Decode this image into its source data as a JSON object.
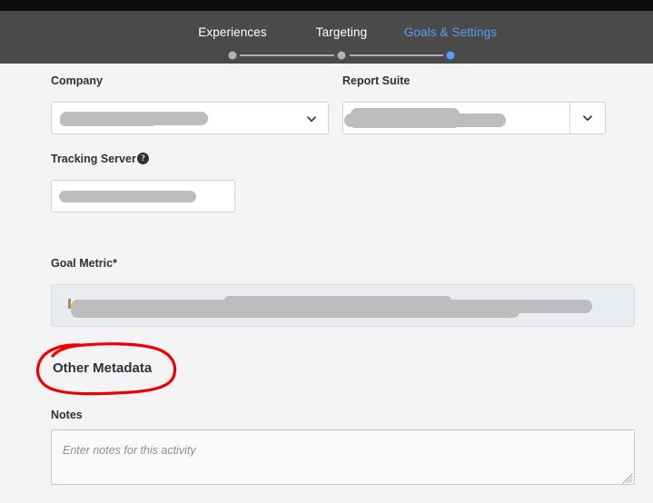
{
  "window": {
    "chrome_color": "#0d0d0d",
    "header_color": "#4a4a4a",
    "page_background": "#f4f4f4",
    "accent_color": "#5a9cf0"
  },
  "wizard": {
    "steps": [
      {
        "label": "Experiences",
        "state": "inactive"
      },
      {
        "label": "Targeting",
        "state": "inactive"
      },
      {
        "label": "Goals & Settings",
        "state": "active"
      }
    ]
  },
  "form": {
    "company": {
      "label": "Company",
      "value": "",
      "redacted": true,
      "chevron_icon": "chevron-down-icon"
    },
    "report_suite": {
      "label": "Report Suite",
      "value": "",
      "redacted": true,
      "chevron_icon": "chevron-down-icon"
    },
    "tracking_server": {
      "label": "Tracking Server",
      "value": "",
      "redacted": true,
      "help_icon": "help-circle-icon",
      "help_glyph": "?"
    },
    "goal_metric": {
      "label": "Goal Metric*",
      "value": "",
      "redacted": true
    }
  },
  "other_metadata": {
    "heading": "Other Metadata",
    "notes": {
      "label": "Notes",
      "value": "",
      "placeholder": "Enter notes for this activity",
      "resize_icon": "resize-grip-icon"
    }
  },
  "annotation": {
    "type": "hand-drawn-ellipse",
    "color": "#ee0000",
    "target": "Other Metadata"
  }
}
